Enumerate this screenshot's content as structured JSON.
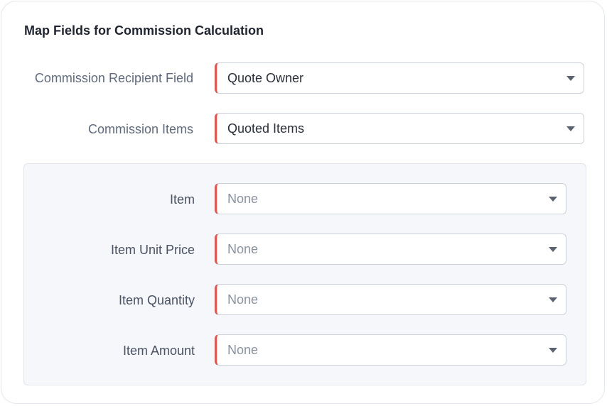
{
  "section": {
    "title": "Map Fields for Commission Calculation"
  },
  "fields": {
    "recipient": {
      "label": "Commission Recipient Field",
      "value": "Quote Owner"
    },
    "items": {
      "label": "Commission Items",
      "value": "Quoted Items"
    }
  },
  "item_mapping": {
    "item": {
      "label": "Item",
      "value": "None"
    },
    "unit_price": {
      "label": "Item Unit Price",
      "value": "None"
    },
    "quantity": {
      "label": "Item Quantity",
      "value": "None"
    },
    "amount": {
      "label": "Item Amount",
      "value": "None"
    }
  },
  "icons": {
    "dropdown": "caret-down-icon"
  },
  "colors": {
    "required_accent": "#e8554f",
    "panel_background": "#f6f7fb"
  }
}
